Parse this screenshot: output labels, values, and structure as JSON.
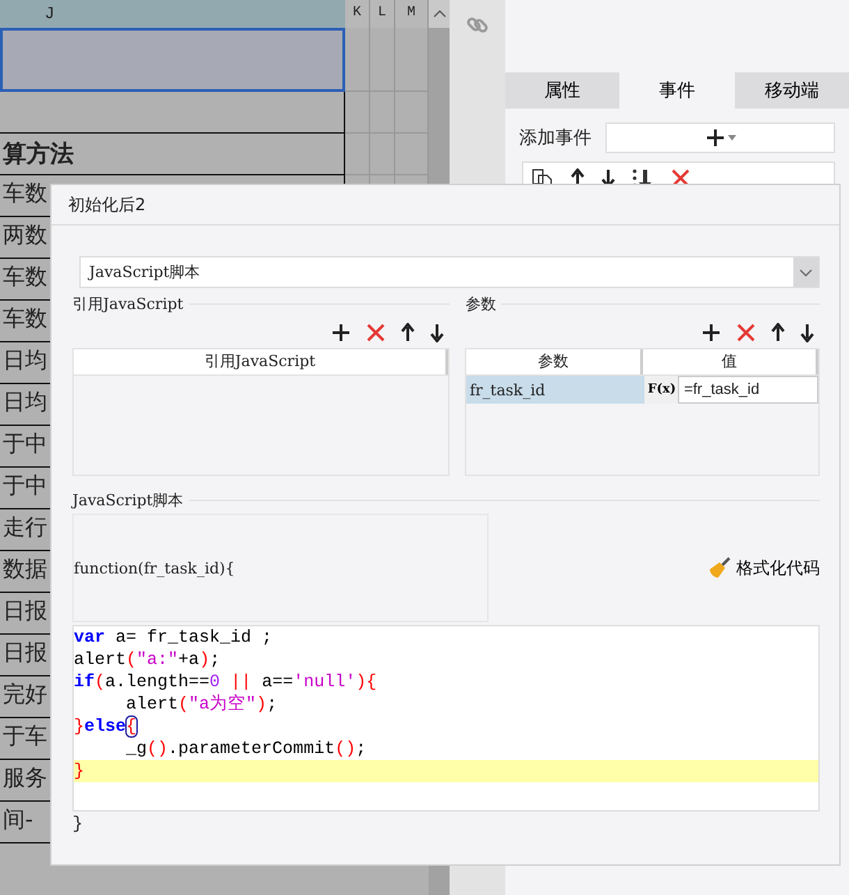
{
  "spreadsheet": {
    "columns": [
      "J",
      "K",
      "L",
      "M"
    ],
    "rows": [
      {
        "text": "",
        "selected": true
      },
      {
        "text": "",
        "selected": false
      },
      {
        "text": "算方法",
        "selected": false
      },
      {
        "text": "车数",
        "selected": false
      },
      {
        "text": "两数",
        "selected": false
      },
      {
        "text": "车数",
        "selected": false
      },
      {
        "text": "车数",
        "selected": false
      },
      {
        "text": "日均",
        "selected": false
      },
      {
        "text": "日均",
        "selected": false
      },
      {
        "text": "于中",
        "selected": false
      },
      {
        "text": "于中",
        "selected": false
      },
      {
        "text": "走行",
        "selected": false
      },
      {
        "text": "数据",
        "selected": false
      },
      {
        "text": "日报",
        "selected": false
      },
      {
        "text": "日报",
        "selected": false
      },
      {
        "text": "完好",
        "selected": false
      },
      {
        "text": "于车",
        "selected": false
      },
      {
        "text": "服务",
        "selected": false
      },
      {
        "text": "间-",
        "selected": false
      }
    ]
  },
  "side_panel": {
    "tabs": [
      {
        "label": "属性",
        "selected": false
      },
      {
        "label": "事件",
        "selected": true
      },
      {
        "label": "移动端",
        "selected": false
      }
    ],
    "add_event_label": "添加事件"
  },
  "dialog": {
    "title": "初始化后2",
    "type_select": "JavaScript脚本",
    "imports": {
      "title": "引用JavaScript",
      "column": "引用JavaScript"
    },
    "params": {
      "title": "参数",
      "columns": [
        "参数",
        "值"
      ],
      "formula_button": "F(x)",
      "rows": [
        {
          "name": "fr_task_id",
          "value": "=fr_task_id",
          "selected": true
        }
      ]
    },
    "script": {
      "title": "JavaScript脚本",
      "signature": "function(fr_task_id){",
      "format_button": "格式化代码",
      "closing": "}",
      "lines": [
        {
          "highlighted": false,
          "tokens": [
            {
              "kind": "keyword",
              "text": "var"
            },
            {
              "kind": "plain",
              "text": " a= fr_task_id ;"
            }
          ]
        },
        {
          "highlighted": false,
          "tokens": [
            {
              "kind": "plain",
              "text": "alert"
            },
            {
              "kind": "bracket",
              "text": "("
            },
            {
              "kind": "string",
              "text": "\"a:\""
            },
            {
              "kind": "plain",
              "text": "+a"
            },
            {
              "kind": "bracket",
              "text": ")"
            },
            {
              "kind": "plain",
              "text": ";"
            }
          ]
        },
        {
          "highlighted": false,
          "tokens": [
            {
              "kind": "keyword",
              "text": "if"
            },
            {
              "kind": "bracket",
              "text": "("
            },
            {
              "kind": "plain",
              "text": "a.length=="
            },
            {
              "kind": "number",
              "text": "0"
            },
            {
              "kind": "operator",
              "text": " ||"
            },
            {
              "kind": "plain",
              "text": " a=="
            },
            {
              "kind": "string",
              "text": "'null'"
            },
            {
              "kind": "bracket",
              "text": ")"
            },
            {
              "kind": "bracket",
              "text": "{"
            }
          ]
        },
        {
          "highlighted": false,
          "tokens": [
            {
              "kind": "plain",
              "text": "     alert"
            },
            {
              "kind": "bracket",
              "text": "("
            },
            {
              "kind": "string",
              "text": "\"a为空\""
            },
            {
              "kind": "bracket",
              "text": ")"
            },
            {
              "kind": "plain",
              "text": ";"
            }
          ]
        },
        {
          "highlighted": false,
          "tokens": [
            {
              "kind": "bracket",
              "text": "}"
            },
            {
              "kind": "keyword",
              "text": "else"
            },
            {
              "kind": "bracket",
              "text": "{",
              "matched": true
            }
          ]
        },
        {
          "highlighted": false,
          "tokens": [
            {
              "kind": "plain",
              "text": "     _g"
            },
            {
              "kind": "bracket",
              "text": "("
            },
            {
              "kind": "bracket",
              "text": ")"
            },
            {
              "kind": "plain",
              "text": ".parameterCommit"
            },
            {
              "kind": "bracket",
              "text": "("
            },
            {
              "kind": "bracket",
              "text": ")"
            },
            {
              "kind": "plain",
              "text": ";"
            }
          ]
        },
        {
          "highlighted": true,
          "tokens": [
            {
              "kind": "bracket",
              "text": "}"
            }
          ]
        }
      ]
    }
  }
}
